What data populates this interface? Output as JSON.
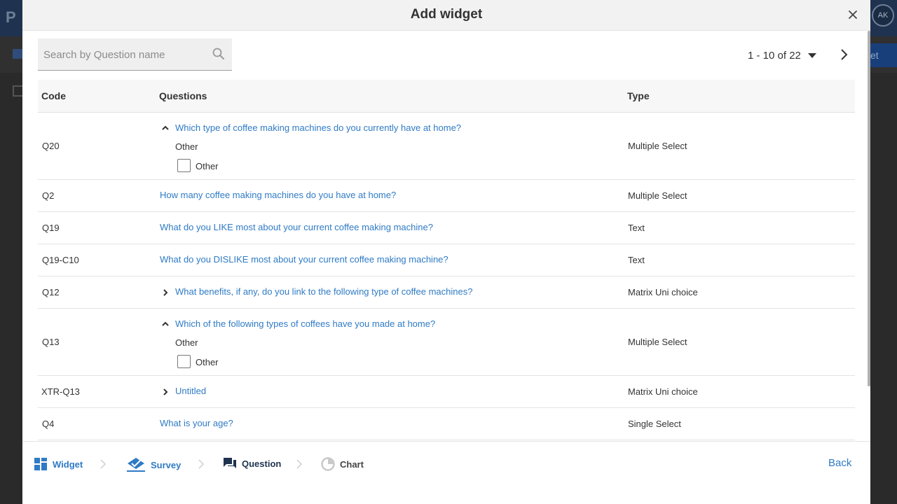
{
  "modal": {
    "title": "Add widget"
  },
  "search": {
    "placeholder": "Search by Question name"
  },
  "pagination": {
    "range": "1 - 10 of 22"
  },
  "table": {
    "headers": {
      "code": "Code",
      "questions": "Questions",
      "type": "Type"
    },
    "rows": [
      {
        "code": "Q20",
        "question": "Which type of coffee making machines do you currently have at home?",
        "type": "Multiple Select",
        "expand": "expanded",
        "sub_label": "Other",
        "option": "Other"
      },
      {
        "code": "Q2",
        "question": "How many coffee making machines do you have at home?",
        "type": "Multiple Select",
        "expand": "none"
      },
      {
        "code": "Q19",
        "question": "What do you LIKE most about your current coffee making machine?",
        "type": "Text",
        "expand": "none"
      },
      {
        "code": "Q19-C10",
        "question": "What do you DISLIKE most about your current coffee making machine?",
        "type": "Text",
        "expand": "none"
      },
      {
        "code": "Q12",
        "question": "What benefits, if any,  do you link to the following type of coffee machines?",
        "type": "Matrix Uni choice",
        "expand": "collapsed"
      },
      {
        "code": "Q13",
        "question": "Which of the following types of coffees have you made at home?",
        "type": "Multiple Select",
        "expand": "expanded",
        "sub_label": "Other",
        "option": "Other"
      },
      {
        "code": "XTR-Q13",
        "question": "Untitled",
        "type": "Matrix Uni choice",
        "expand": "collapsed"
      },
      {
        "code": "Q4",
        "question": "What is your age?",
        "type": "Single Select",
        "expand": "none"
      }
    ]
  },
  "stepper": {
    "steps": [
      {
        "label": "Widget",
        "state": "done",
        "icon": "widget-grid-icon"
      },
      {
        "label": "Survey",
        "state": "done",
        "icon": "survey-check-icon"
      },
      {
        "label": "Question",
        "state": "active",
        "icon": "question-chat-icon"
      },
      {
        "label": "Chart",
        "state": "pending",
        "icon": "chart-pie-icon"
      }
    ],
    "back_label": "Back"
  },
  "background": {
    "avatar_initials": "AK",
    "button_fragment": "et"
  },
  "colors": {
    "link": "#2f7bc5",
    "modal_header": "#f2f2f2",
    "overlay": "#2a2a2a",
    "active_step": "#1f3350"
  }
}
